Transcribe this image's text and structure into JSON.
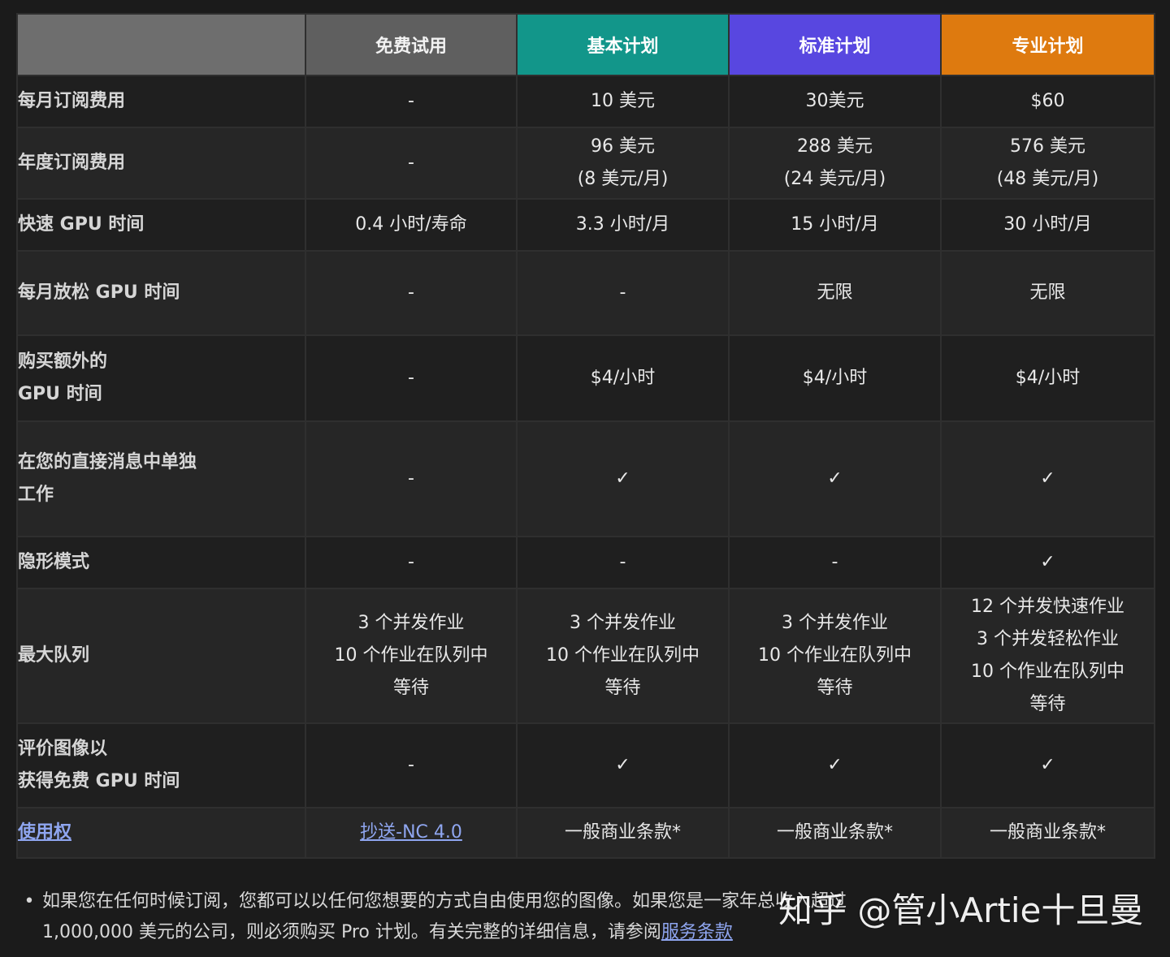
{
  "header": {
    "corner": "",
    "plans": [
      "免费试用",
      "基本计划",
      "标准计划",
      "专业计划"
    ]
  },
  "rows": [
    {
      "label": [
        "每月订阅费用"
      ],
      "cells": [
        [
          "-"
        ],
        [
          "10 美元"
        ],
        [
          "30美元"
        ],
        [
          "$60"
        ]
      ]
    },
    {
      "label": [
        "年度订阅费用"
      ],
      "cells": [
        [
          "-"
        ],
        [
          "96 美元",
          "(8 美元/月)"
        ],
        [
          "288 美元",
          "(24 美元/月)"
        ],
        [
          "576 美元",
          "(48 美元/月)"
        ]
      ]
    },
    {
      "label": [
        "快速 GPU 时间"
      ],
      "cells": [
        [
          "0.4 小时/寿命"
        ],
        [
          "3.3 小时/月"
        ],
        [
          "15 小时/月"
        ],
        [
          "30 小时/月"
        ]
      ]
    },
    {
      "label": [
        "每月放松 GPU 时间"
      ],
      "cells": [
        [
          "-"
        ],
        [
          "-"
        ],
        [
          "无限"
        ],
        [
          "无限"
        ]
      ]
    },
    {
      "label": [
        "购买额外的",
        "GPU 时间"
      ],
      "cells": [
        [
          "-"
        ],
        [
          "$4/小时"
        ],
        [
          "$4/小时"
        ],
        [
          "$4/小时"
        ]
      ]
    },
    {
      "label": [
        "在您的直接消息中单独",
        "工作"
      ],
      "cells": [
        [
          "-"
        ],
        [
          "✓"
        ],
        [
          "✓"
        ],
        [
          "✓"
        ]
      ]
    },
    {
      "label": [
        "隐形模式"
      ],
      "cells": [
        [
          "-"
        ],
        [
          "-"
        ],
        [
          "-"
        ],
        [
          "✓"
        ]
      ]
    },
    {
      "label": [
        "最大队列"
      ],
      "cells": [
        [
          "3 个并发作业",
          "10 个作业在队列中",
          "等待"
        ],
        [
          "3 个并发作业",
          "10 个作业在队列中",
          "等待"
        ],
        [
          "3 个并发作业",
          "10 个作业在队列中",
          "等待"
        ],
        [
          "12 个并发快速作业",
          "3 个并发轻松作业",
          "10 个作业在队列中",
          "等待"
        ]
      ]
    },
    {
      "label": [
        "评价图像以",
        "获得免费 GPU 时间"
      ],
      "cells": [
        [
          "-"
        ],
        [
          "✓"
        ],
        [
          "✓"
        ],
        [
          "✓"
        ]
      ]
    }
  ],
  "usage_row": {
    "label": "使用权",
    "cells": [
      "抄送-NC 4.0",
      "一般商业条款*",
      "一般商业条款*",
      "一般商业条款*"
    ]
  },
  "footnote": {
    "bullet": "•",
    "text": "如果您在任何时候订阅，您都可以以任何您想要的方式自由使用您的图像。如果您是一家年总收入超过 1,000,000 美元的公司，则必须购买 Pro 计划。有关完整的详细信息，请参阅",
    "link": "服务条款"
  },
  "watermark": "知乎 @管小Artie十旦曼",
  "colors": {
    "free": "#5f5f5f",
    "basic": "#12968a",
    "standard": "#5847e0",
    "pro": "#de7a0f",
    "link": "#8fa6f0"
  }
}
